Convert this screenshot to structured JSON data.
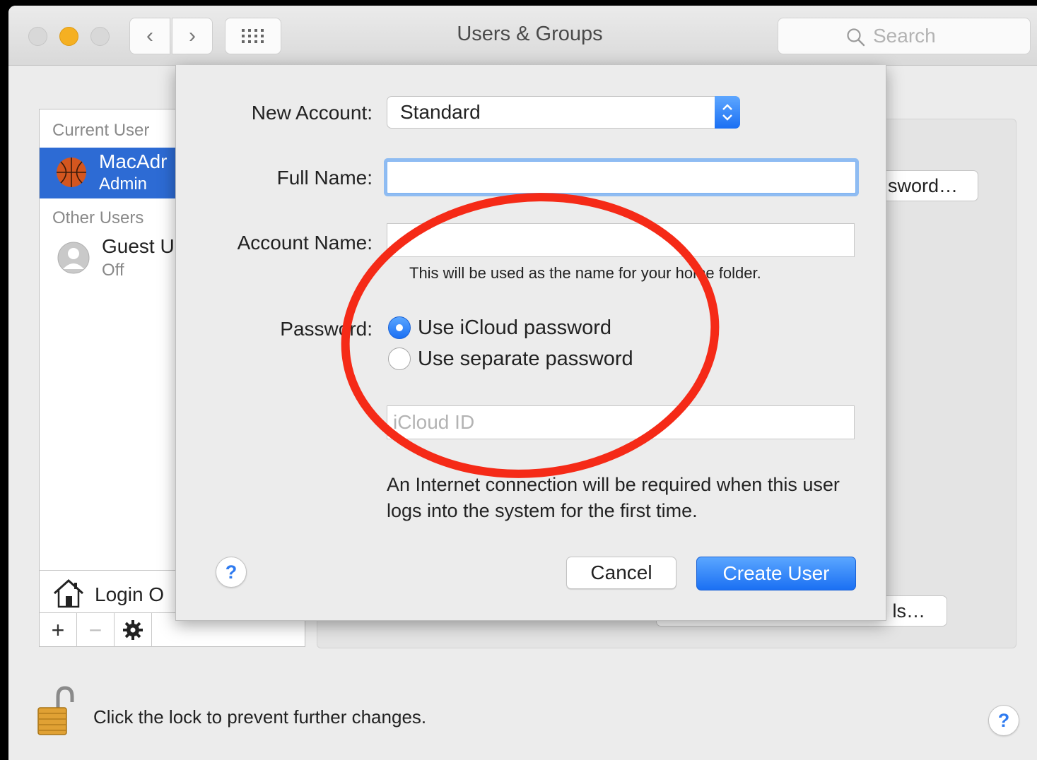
{
  "window": {
    "title": "Users & Groups",
    "search_placeholder": "Search"
  },
  "toolbar": {
    "back_icon": "‹",
    "forward_icon": "›",
    "grid_icon": "show-all-grid"
  },
  "user_list": {
    "current_user_header": "Current User",
    "current_user": {
      "name": "MacAdr",
      "role": "Admin"
    },
    "other_users_header": "Other Users",
    "other_users": [
      {
        "name": "Guest U",
        "status": "Off"
      }
    ],
    "login_options_label": "Login O",
    "add_label": "+",
    "remove_label": "−"
  },
  "background_buttons": {
    "change_password": "sword…",
    "parental_controls": "ls…"
  },
  "lock": {
    "text": "Click the lock to prevent further changes."
  },
  "sheet": {
    "new_account_label": "New Account:",
    "account_type": "Standard",
    "full_name_label": "Full Name:",
    "full_name_value": "",
    "account_name_label": "Account Name:",
    "account_name_value": "",
    "account_name_hint": "This will be used as the name for your home folder.",
    "password_label": "Password:",
    "password_options": [
      {
        "label": "Use iCloud password",
        "selected": true
      },
      {
        "label": "Use separate password",
        "selected": false
      }
    ],
    "icloud_id_placeholder": "iCloud ID",
    "internet_note": "An Internet connection will be required when this user logs into the system for the first time.",
    "help_label": "?",
    "cancel_label": "Cancel",
    "create_label": "Create User"
  },
  "help_label": "?",
  "colors": {
    "accent": "#2d6bd4",
    "annotation": "#f52a17"
  }
}
